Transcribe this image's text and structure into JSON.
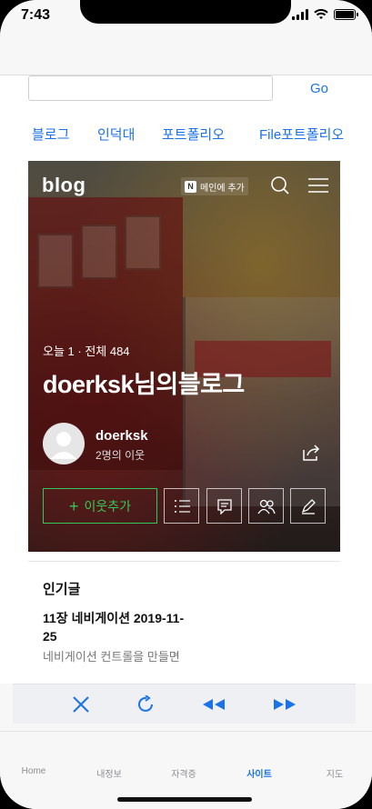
{
  "status_bar": {
    "time": "7:43"
  },
  "browser": {
    "url_value": "",
    "go_label": "Go",
    "links": [
      "블로그",
      "인덕대",
      "포트폴리오",
      "File포트폴리오"
    ]
  },
  "blog": {
    "logo": "blog",
    "add_to_main": "메인에 추가",
    "counts": "오늘 1 · 전체 484",
    "title": "doerksk님의블로그",
    "user_name": "doerksk",
    "neighbors": "2명의 이웃",
    "add_neighbor": "이웃추가",
    "popular_heading": "인기글",
    "post_title": "11장 네비게이션 2019-11-25",
    "post_desc": "네비게이션 컨트롤을 만들면"
  },
  "toolbar": {
    "icons": [
      "close-icon",
      "refresh-icon",
      "rewind-icon",
      "fast-forward-icon"
    ]
  },
  "tabbar": {
    "tabs": [
      "Home",
      "내정보",
      "자격증",
      "사이트",
      "지도"
    ],
    "active": "사이트"
  },
  "colors": {
    "accent": "#1a73e8",
    "green": "#34c759"
  }
}
